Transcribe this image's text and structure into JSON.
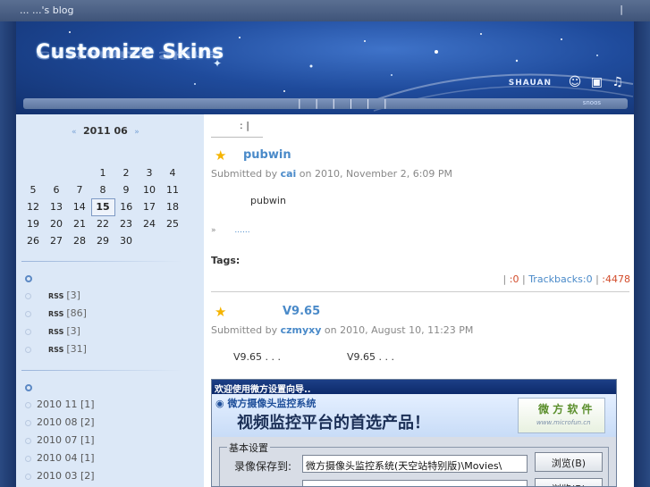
{
  "topbar": {
    "blog_title": "... ...'s blog",
    "separator": "|"
  },
  "header": {
    "logo_text": "Customize Skins",
    "shauan_text": "SHAUAN",
    "nav_ticks": "| | | | | |",
    "nav_small": "snoos"
  },
  "calendar": {
    "prev": "«",
    "month_label": "2011 06",
    "next": "»",
    "weeks": [
      [
        "",
        "",
        "",
        "1",
        "2",
        "3",
        "4"
      ],
      [
        "5",
        "6",
        "7",
        "8",
        "9",
        "10",
        "11"
      ],
      [
        "12",
        "13",
        "14",
        "15",
        "16",
        "17",
        "18"
      ],
      [
        "19",
        "20",
        "21",
        "22",
        "23",
        "24",
        "25"
      ],
      [
        "26",
        "27",
        "28",
        "29",
        "30",
        "",
        ""
      ]
    ],
    "today": "15"
  },
  "rss": {
    "items": [
      {
        "badge": "RSS",
        "count": "[3]"
      },
      {
        "badge": "RSS",
        "count": "[86]"
      },
      {
        "badge": "RSS",
        "count": "[3]"
      },
      {
        "badge": "RSS",
        "count": "[31]"
      }
    ]
  },
  "archive": {
    "items": [
      {
        "label": "2010 11",
        "count": "[1]"
      },
      {
        "label": "2010 08",
        "count": "[2]"
      },
      {
        "label": "2010 07",
        "count": "[1]"
      },
      {
        "label": "2010 04",
        "count": "[1]"
      },
      {
        "label": "2010 03",
        "count": "[2]"
      }
    ]
  },
  "main": {
    "meta_top": ": |",
    "post1": {
      "title": "pubwin",
      "submitted_prefix": "Submitted by",
      "author": "cai",
      "date": "on 2010, November 2, 6:09 PM",
      "body": "pubwin",
      "readmore_mark": "»",
      "readmore_dots": "......",
      "tags_label": "Tags:",
      "links": {
        "sep1": "|",
        "comments": ":0",
        "sep2": "|",
        "trackbacks": "Trackbacks:0",
        "sep3": "|",
        "reads": ":4478"
      }
    },
    "post2": {
      "title": "V9.65",
      "submitted_prefix": "Submitted by",
      "author": "czmyxy",
      "date": "on 2010, August 10, 11:23 PM",
      "body_a": "V9.65 . . .",
      "body_b": "V9.65 . . ."
    }
  },
  "app_window": {
    "title": "欢迎使用微方设置向导..",
    "system_name": "微方摄像头监控系统",
    "slogan": "视频监控平台的首选产品！",
    "brand_name": "微 方 软 件",
    "brand_url": "www.microfun.cn",
    "group_label": "基本设置",
    "save_label": "录像保存到:",
    "save_path": "微方摄像头监控系统(天空站特别版)\\Movies\\",
    "browse_label": "浏览(B)",
    "browse2_label": "浏览(B)"
  }
}
